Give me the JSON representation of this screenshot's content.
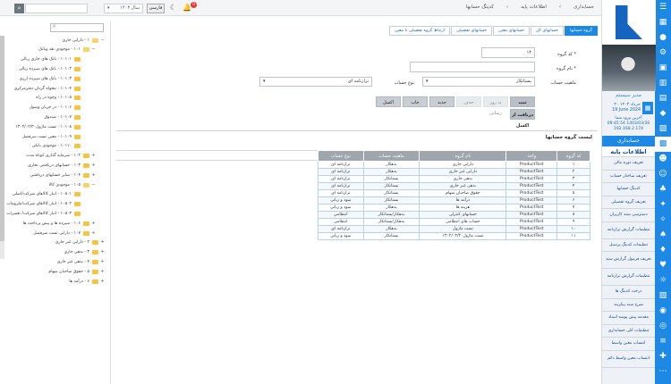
{
  "topbar": {
    "breadcrumbs": [
      "حسابداری",
      "اطلاعات پایه",
      "کدینگ حسابها"
    ],
    "year": "سال ۱۴۰۳",
    "lang": "فارسی",
    "notif_count": "0"
  },
  "user": {
    "name": "مدیر سیستم",
    "date_fa": "۳۰ خرداد ۱۴۰۳",
    "date_en": "19 June 2024",
    "last_login_label": "آخرین ورود شما",
    "last_login_time": "09:45:54 1403/03/30",
    "ip": "192.168.2.174"
  },
  "sidebar": {
    "section_title": "حسابداری",
    "info_title": "اطلاعات پایه",
    "items": [
      "تعریف دوره مالی",
      "تعریف ساختار حساب",
      "کدینگ حسابها",
      "تعریف گروه تفصیلی",
      "دسترسی سند کاربران",
      "تنظیمات گزارش ترازنامه",
      "تنظیمات کدینگ پرسنل",
      "تعریف فرمول گزارش سند",
      "تنظیمات گزارش ترازنامه",
      "درخت کدینگ ها",
      "شرح سند پیکربند",
      "مقدمه پیش پوشه اسناد",
      "تنظیمات کلی حسابداری",
      "انتساب معین واسط",
      "انتساب معین واسط دائم"
    ]
  },
  "tree": {
    "rows": [
      {
        "text": "۱ - دارایی جاری",
        "level": 0,
        "open": true
      },
      {
        "text": "۱۰۱ - موجودی نقد وبانک",
        "level": 1,
        "open": true
      },
      {
        "text": "۱۰۱۰۱ - بانک های جاری ریالی",
        "level": 2
      },
      {
        "text": "۱۰۱۰۲ - بانک های سپرده ریالی",
        "level": 2
      },
      {
        "text": "۱۰۱۰۳ - بانک های سپرده ارزی",
        "level": 2
      },
      {
        "text": "۱۰۱۰۴ - تنخواه گردان دفترمرکزی",
        "level": 2
      },
      {
        "text": "۱۰۱۰۵ - وجوه در راه",
        "level": 2
      },
      {
        "text": "۱۰۱۰۶ - در جریان وصول",
        "level": 2
      },
      {
        "text": "۱۰۱۰۷ - صندوق",
        "level": 2
      },
      {
        "text": "۱۰۱۰۸ - تست ماژول۱۳۰۲/۰۲/۳۰",
        "level": 2
      },
      {
        "text": "۱۰۱۰۹ - معین تست سرفصل",
        "level": 2
      },
      {
        "text": "۱۰۱۱۰ - موجودی بانکی",
        "level": 2
      },
      {
        "text": "۱۰۲ - سرمایه گذاری کوتاه مدت",
        "level": 1
      },
      {
        "text": "۱۰۳ - حسابهای دریافتنی تجاری",
        "level": 1
      },
      {
        "text": "۱۰۴ - سایر حسابهای دریافتنی",
        "level": 1
      },
      {
        "text": "۱۰۵ - موجودی کالا",
        "level": 1,
        "open": true
      },
      {
        "text": "۱۰۵۰۱ - انبار کالاهای شرکت/اصلی",
        "level": 2
      },
      {
        "text": "۱۰۵۰۲ - انبار کالاهای شرکت/ملزومات",
        "level": 2
      },
      {
        "text": "۱۰۵۰۳ - انبار کالاهای شرکت/ تعمیرات",
        "level": 2
      },
      {
        "text": "۱۰۶ - سپرده ها و پیش پرداخت ها",
        "level": 1
      },
      {
        "text": "۱۰۷ - دارایی تست سرفصل",
        "level": 1
      },
      {
        "text": "۲ - دارایی غیر جاری",
        "level": 0
      },
      {
        "text": "۳ - بدهی جاری",
        "level": 0
      },
      {
        "text": "۴ - بدهی غیر جاری",
        "level": 0
      },
      {
        "text": "۵ - حقوق صاحبان سهام",
        "level": 0
      },
      {
        "text": "۶ - درآمد ها",
        "level": 0
      }
    ]
  },
  "tabs": [
    "گروه حسابها",
    "حسابهای کل",
    "حسابهای معین",
    "حسابهای تفصیلی",
    "ارتباط گروه تفصیلی با معین"
  ],
  "form": {
    "code_label": "کد گروه *",
    "code_value": "۱۴",
    "name_label": "نام گروه *",
    "nature_label": "ماهیت حساب",
    "nature_value": "بستانکار",
    "type_label": "نوع حساب",
    "type_value": "ترازنامه ای"
  },
  "buttons": {
    "save": "ثبت",
    "update": "به روز رسانی",
    "delete": "حذف",
    "new": "جدید",
    "print": "چاپ",
    "excel": "اکسل",
    "import_excel": "دریافت از اکسل"
  },
  "list": {
    "title": "لیست گروه حسابها",
    "columns": [
      "کد گروه",
      "واحد",
      "نام گروه",
      "ماهیت حساب",
      "نوع حساب"
    ],
    "rows": [
      [
        "۱",
        "ProductTest",
        "دارایی جاری",
        "بدهکار",
        "ترازنامه ای"
      ],
      [
        "۲",
        "ProductTest",
        "دارایی غیر جاری",
        "بدهکار",
        "ترازنامه ای"
      ],
      [
        "۳",
        "ProductTest",
        "بدهی جاری",
        "بستانکار",
        "ترازنامه ای"
      ],
      [
        "۴",
        "ProductTest",
        "بدهی غیر جاری",
        "بستانکار",
        "ترازنامه ای"
      ],
      [
        "۵",
        "ProductTest",
        "حقوق صاحبان سهام",
        "بستانکار",
        "ترازنامه ای"
      ],
      [
        "۶",
        "ProductTest",
        "درآمد ها",
        "بستانکار",
        "سود و زیانی"
      ],
      [
        "۷",
        "ProductTest",
        "هزینه ها",
        "بدهکار",
        "سود و زیانی"
      ],
      [
        "۸",
        "ProductTest",
        "حسابهای کنترلی",
        "بدهکار/بستانکار",
        "انتظامی"
      ],
      [
        "۹",
        "ProductTest",
        "حساب های انتظامی",
        "بدهکار/بستانکار",
        "انتظامی"
      ],
      [
        "۱۰",
        "ProductTest",
        "تست ماژول",
        "بدهکار",
        "ترازنامه ای"
      ],
      [
        "۱۱",
        "ProductTest",
        "تست ماژول۱۳۰۲/۰۲/۳۰",
        "بستانکار",
        "سود و زیانی"
      ]
    ]
  }
}
